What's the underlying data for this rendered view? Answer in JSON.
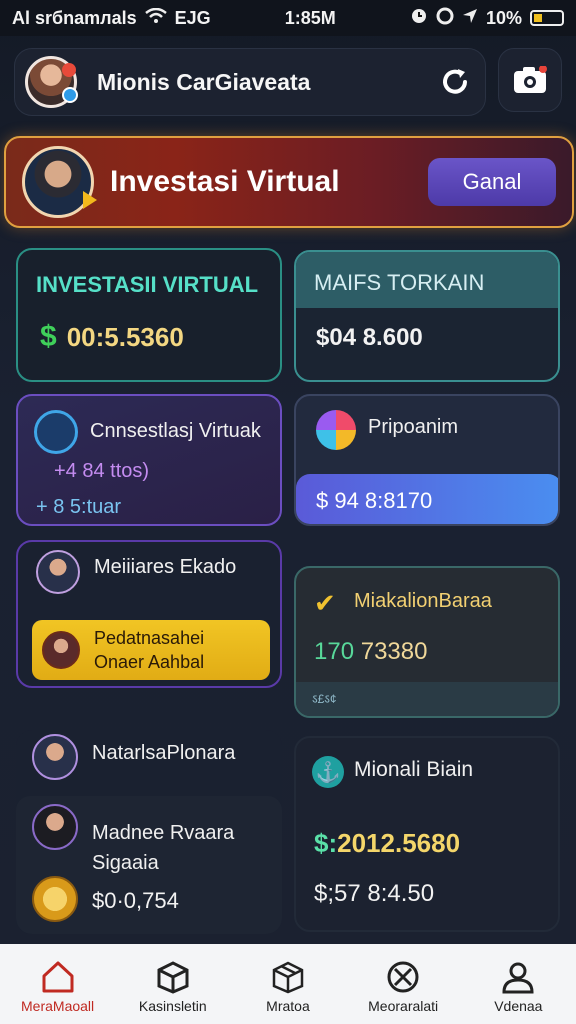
{
  "status": {
    "left": "Al srбnamлals",
    "mid": "ЕJG",
    "time": "1:85M",
    "battery": "10%"
  },
  "header": {
    "name": "Mionis CarGiaveata"
  },
  "banner": {
    "title": "Investasi Virtual",
    "button": "Ganal"
  },
  "cards": {
    "c1": {
      "title": "INVESTASII VIRTUAL",
      "currency": "$",
      "value": "00:5.5360"
    },
    "c2": {
      "title": "MAIFS TORKAIN",
      "value": "$04 8.600"
    },
    "c3": {
      "title": "Cnnsestlasj Virtuak",
      "line1": "+4 84 ttos)",
      "line2": "+ 8 5:tuar"
    },
    "c4": {
      "title": "Pripoanim",
      "value": "$ 94 8:8170"
    },
    "c5": {
      "title": "Meiiiares Ekado",
      "line1": "Pedatnasahei",
      "line2": "Onaer Aahbal"
    },
    "c6": {
      "title": "MiakalionBaraa",
      "value_a": "170",
      "value_b": "73380",
      "footer": "ऽ£ऽ¢"
    },
    "c7": {
      "title": "NatarlsaPlonara",
      "name1": "Madnee Rvaara",
      "name2": "Sigaaia",
      "value": "$0·0,754"
    },
    "c8": {
      "title": "Mionali Biain",
      "value_a": "$:",
      "value_b": "2012.5680",
      "value2": "$;57 8:4.50"
    }
  },
  "nav": [
    {
      "label": "MeraMaoall",
      "icon": "home-icon"
    },
    {
      "label": "Kasinsletin",
      "icon": "box-icon"
    },
    {
      "label": "Mratoa",
      "icon": "package-icon"
    },
    {
      "label": "Meoraralati",
      "icon": "cancel-icon"
    },
    {
      "label": "Vdenaa",
      "icon": "user-icon"
    }
  ]
}
